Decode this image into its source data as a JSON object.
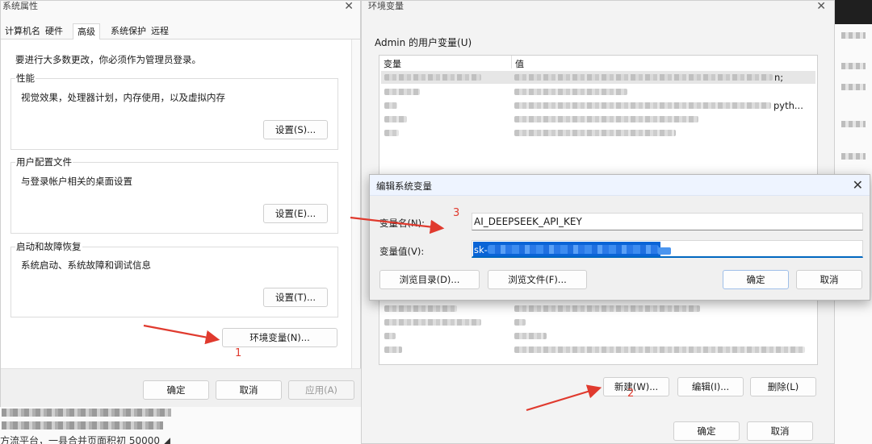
{
  "system_properties": {
    "title": "系统属性",
    "tabs": [
      "计算机名",
      "硬件",
      "高级",
      "系统保护",
      "远程"
    ],
    "active_tab": "高级",
    "admin_note": "要进行大多数更改，你必须作为管理员登录。",
    "groups": [
      {
        "label": "性能",
        "desc": "视觉效果，处理器计划，内存使用，以及虚拟内存",
        "button": "设置(S)..."
      },
      {
        "label": "用户配置文件",
        "desc": "与登录帐户相关的桌面设置",
        "button": "设置(E)..."
      },
      {
        "label": "启动和故障恢复",
        "desc": "系统启动、系统故障和调试信息",
        "button": "设置(T)..."
      }
    ],
    "env_button": "环境变量(N)...",
    "ok": "确定",
    "cancel": "取消",
    "apply": "应用(A)"
  },
  "env_vars": {
    "title": "环境变量",
    "user_section_label": "Admin 的用户变量(U)",
    "col_variable": "变量",
    "col_value": "值",
    "user_rows_tail": [
      "n;",
      "",
      "pyth...",
      "",
      ""
    ],
    "new_button": "新建(W)...",
    "edit_button": "编辑(I)...",
    "delete_button": "删除(L)",
    "ok": "确定",
    "cancel": "取消"
  },
  "edit_dialog": {
    "title": "编辑系统变量",
    "name_label": "变量名(N):",
    "name_value": "AI_DEEPSEEK_API_KEY",
    "value_label": "变量值(V):",
    "value_prefix": "sk-",
    "browse_dir": "浏览目录(D)...",
    "browse_file": "浏览文件(F)...",
    "ok": "确定",
    "cancel": "取消"
  },
  "annotations": {
    "step1": "1",
    "step2": "2",
    "step3": "3",
    "color": "#e03a2e"
  },
  "background": {
    "bottom_text": "方流平台，一县合并页面积初 50000 ◢"
  }
}
